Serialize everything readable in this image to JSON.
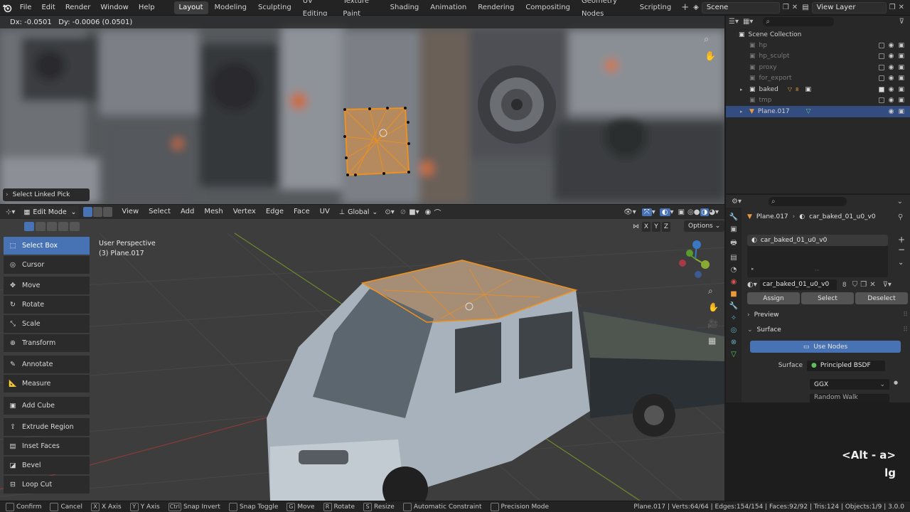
{
  "topbar": {
    "menus": [
      "File",
      "Edit",
      "Render",
      "Window",
      "Help"
    ],
    "workspaces": [
      "Layout",
      "Modeling",
      "Sculpting",
      "UV Editing",
      "Texture Paint",
      "Shading",
      "Animation",
      "Rendering",
      "Compositing",
      "Geometry Nodes",
      "Scripting"
    ],
    "active_workspace": "Layout",
    "add_tab": "+",
    "scene": "Scene",
    "view_layer": "View Layer"
  },
  "uv_view": {
    "header_text": "Dx: -0.0501   Dy: -0.0006 (0.0501)",
    "operator_panel": "Select Linked Pick"
  },
  "outliner": {
    "root": "Scene Collection",
    "items": [
      {
        "label": "hp",
        "state": "dim"
      },
      {
        "label": "hp_sculpt",
        "state": "dim"
      },
      {
        "label": "proxy",
        "state": "dim"
      },
      {
        "label": "for_export",
        "state": "dim"
      },
      {
        "label": "baked",
        "state": "normal",
        "badge": "8"
      },
      {
        "label": "tmp",
        "state": "dim"
      },
      {
        "label": "Plane.017",
        "state": "selected"
      }
    ]
  },
  "properties": {
    "breadcrumb_object": "Plane.017",
    "breadcrumb_material": "car_baked_01_u0_v0",
    "slot_name": "car_baked_01_u0_v0",
    "material_field": "car_baked_01_u0_v0",
    "user_count": "8",
    "assign": "Assign",
    "select": "Select",
    "deselect": "Deselect",
    "preview_panel": "Preview",
    "surface_panel": "Surface",
    "use_nodes": "Use Nodes",
    "surface_label": "Surface",
    "surface_value": "Principled BSDF",
    "distribution": "GGX",
    "subsurface_method": "Random Walk"
  },
  "view3d_header": {
    "mode": "Edit Mode",
    "menus": [
      "View",
      "Select",
      "Add",
      "Mesh",
      "Vertex",
      "Edge",
      "Face",
      "UV"
    ],
    "orientation": "Global",
    "axes": [
      "X",
      "Y",
      "Z"
    ],
    "options": "Options"
  },
  "view3d": {
    "perspective": "User Perspective",
    "object_info": "(3) Plane.017"
  },
  "tools": [
    {
      "label": "Select Box",
      "icon": "select-box-icon",
      "active": true
    },
    {
      "label": "Cursor",
      "icon": "cursor-icon"
    },
    {
      "label": "Move",
      "icon": "move-icon"
    },
    {
      "label": "Rotate",
      "icon": "rotate-icon"
    },
    {
      "label": "Scale",
      "icon": "scale-icon"
    },
    {
      "label": "Transform",
      "icon": "transform-icon"
    },
    {
      "label": "Annotate",
      "icon": "annotate-icon"
    },
    {
      "label": "Measure",
      "icon": "measure-icon"
    },
    {
      "label": "Add Cube",
      "icon": "add-cube-icon"
    },
    {
      "label": "Extrude Region",
      "icon": "extrude-region-icon"
    },
    {
      "label": "Inset Faces",
      "icon": "inset-faces-icon"
    },
    {
      "label": "Bevel",
      "icon": "bevel-icon"
    },
    {
      "label": "Loop Cut",
      "icon": "loop-cut-icon"
    }
  ],
  "overlay_keys": {
    "shortcut": "<Alt - a>",
    "second": "lg"
  },
  "statusbar": {
    "items": [
      {
        "key": "",
        "label": "Confirm"
      },
      {
        "key": "",
        "label": "Cancel"
      },
      {
        "key": "X",
        "label": "X Axis"
      },
      {
        "key": "Y",
        "label": "Y Axis"
      },
      {
        "key": "Ctrl",
        "label": "Snap Invert"
      },
      {
        "key": "",
        "label": "Snap Toggle"
      },
      {
        "key": "G",
        "label": "Move"
      },
      {
        "key": "R",
        "label": "Rotate"
      },
      {
        "key": "S",
        "label": "Resize"
      },
      {
        "key": "",
        "label": "Automatic Constraint"
      },
      {
        "key": "",
        "label": "Precision Mode"
      }
    ],
    "stats": "Plane.017 | Verts:64/64 | Edges:154/154 | Faces:92/92 | Tris:124 | Objects:1/9 | 3.0.0"
  },
  "colors": {
    "accent_blue": "#4772b3",
    "selection_orange": "#f0901e",
    "outliner_selected": "#334d80"
  }
}
